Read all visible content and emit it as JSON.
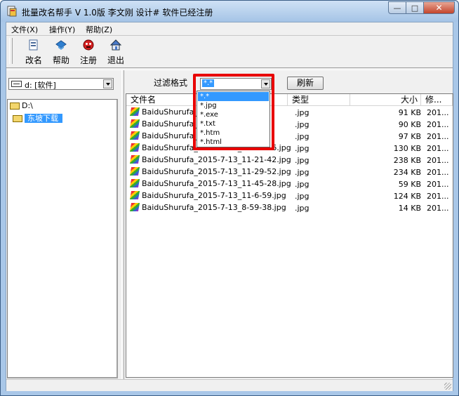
{
  "window": {
    "title": "批量改名帮手  V 1.0版  李文刚 设计# 软件已经注册",
    "min_glyph": "—",
    "max_glyph": "□",
    "close_glyph": "✕"
  },
  "menu": {
    "items": [
      {
        "label": "文件(X)"
      },
      {
        "label": "操作(Y)"
      },
      {
        "label": "帮助(Z)"
      }
    ]
  },
  "toolbar": {
    "buttons": [
      {
        "label": "改名",
        "icon": "rename-icon"
      },
      {
        "label": "帮助",
        "icon": "help-icon"
      },
      {
        "label": "注册",
        "icon": "register-icon"
      },
      {
        "label": "退出",
        "icon": "exit-icon"
      }
    ]
  },
  "drive": {
    "value": "d: [软件]"
  },
  "tree": {
    "root": "D:\\",
    "selected": "东坡下载"
  },
  "filter": {
    "label": "过滤格式",
    "value": "*.*",
    "refresh_label": "刷新",
    "options": [
      "*.*",
      "*.jpg",
      "*.exe",
      "*.txt",
      "*.htm",
      "*.html"
    ]
  },
  "files": {
    "columns": [
      "文件名",
      "类型",
      "大小",
      "修..."
    ],
    "rows": [
      {
        "name": "BaiduShurufa_2",
        "type": ".jpg",
        "size": "91 KB",
        "modified": "201..."
      },
      {
        "name": "BaiduShurufa_2",
        "type": ".jpg",
        "size": "90 KB",
        "modified": "201..."
      },
      {
        "name": "BaiduShurufa_2",
        "type": ".jpg",
        "size": "97 KB",
        "modified": "201..."
      },
      {
        "name": "BaiduShurufa_2015-7-13_10-31-16.jpg",
        "type": ".jpg",
        "size": "130 KB",
        "modified": "201..."
      },
      {
        "name": "BaiduShurufa_2015-7-13_11-21-42.jpg",
        "type": ".jpg",
        "size": "238 KB",
        "modified": "201..."
      },
      {
        "name": "BaiduShurufa_2015-7-13_11-29-52.jpg",
        "type": ".jpg",
        "size": "234 KB",
        "modified": "201..."
      },
      {
        "name": "BaiduShurufa_2015-7-13_11-45-28.jpg",
        "type": ".jpg",
        "size": "59 KB",
        "modified": "201..."
      },
      {
        "name": "BaiduShurufa_2015-7-13_11-6-59.jpg",
        "type": ".jpg",
        "size": "124 KB",
        "modified": "201..."
      },
      {
        "name": "BaiduShurufa_2015-7-13_8-59-38.jpg",
        "type": ".jpg",
        "size": "14 KB",
        "modified": "201..."
      }
    ]
  },
  "colors": {
    "selection": "#3399ff",
    "highlight_border": "#e80000",
    "titlebar": "#a9c7e8"
  }
}
